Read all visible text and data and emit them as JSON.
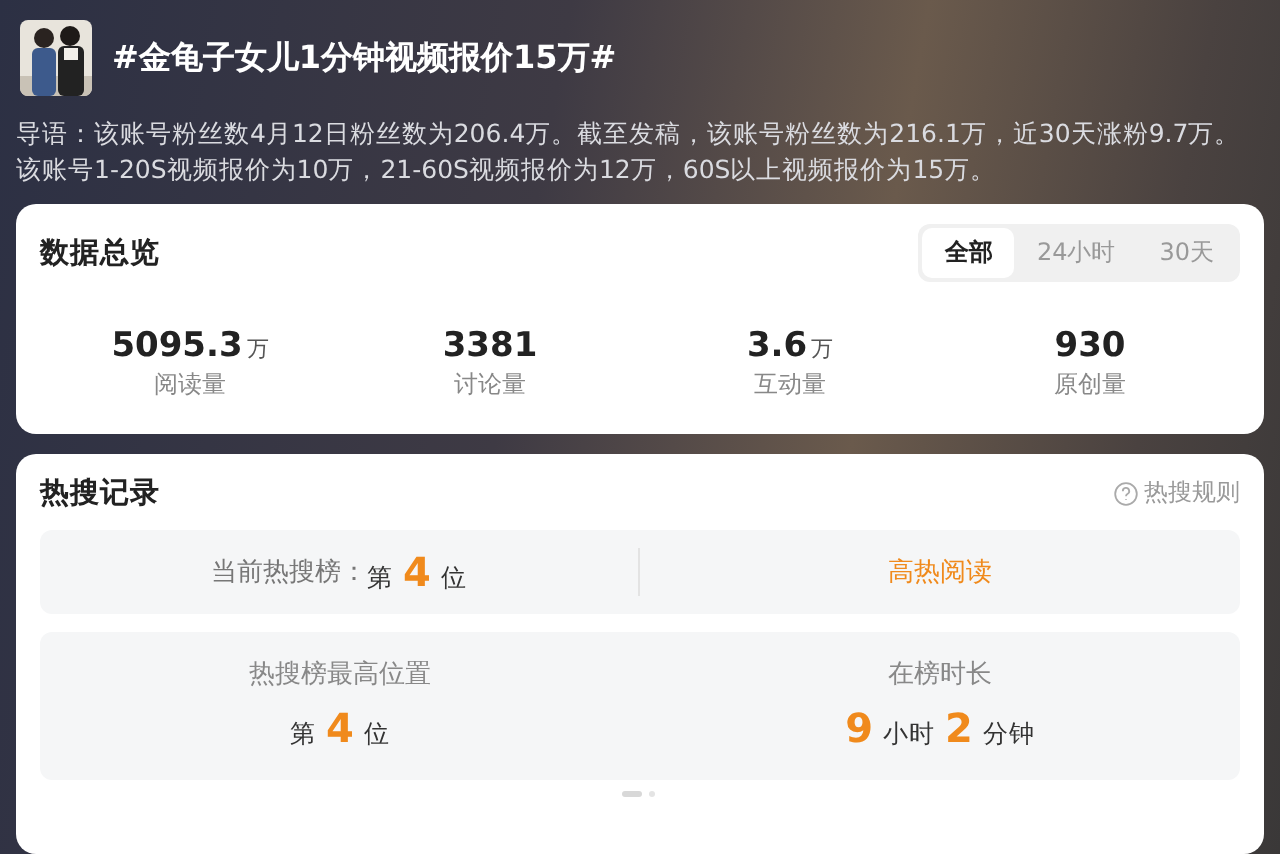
{
  "topic": {
    "title": "#金龟子女儿1分钟视频报价15万#",
    "intro": "导语：该账号粉丝数4月12日粉丝数为206.4万。截至发稿，该账号粉丝数为216.1万，近30天涨粉9.7万。该账号1-20S视频报价为10万，21-60S视频报价为12万，60S以上视频报价为15万。"
  },
  "overview": {
    "title": "数据总览",
    "tabs": [
      {
        "label": "全部",
        "selected": true
      },
      {
        "label": "24小时",
        "selected": false
      },
      {
        "label": "30天",
        "selected": false
      }
    ],
    "stats": [
      {
        "value": "5095.3",
        "unit": "万",
        "label": "阅读量"
      },
      {
        "value": "3381",
        "label": "讨论量"
      },
      {
        "value": "3.6",
        "unit": "万",
        "label": "互动量"
      },
      {
        "value": "930",
        "label": "原创量"
      }
    ]
  },
  "hot_record": {
    "title": "热搜记录",
    "rules_link": "热搜规则",
    "current": {
      "label": "当前热搜榜：",
      "parts": [
        {
          "text": "第",
          "kind": "unit"
        },
        {
          "text": "4",
          "kind": "number"
        },
        {
          "text": "位",
          "kind": "unit"
        }
      ]
    },
    "tag": "高热阅读",
    "details": [
      {
        "label": "热搜榜最高位置",
        "parts": [
          {
            "text": "第",
            "kind": "unit"
          },
          {
            "text": "4",
            "kind": "number"
          },
          {
            "text": "位",
            "kind": "unit"
          }
        ]
      },
      {
        "label": "在榜时长",
        "parts": [
          {
            "text": "9",
            "kind": "number"
          },
          {
            "text": "小时",
            "kind": "unit"
          },
          {
            "text": "2",
            "kind": "number"
          },
          {
            "text": "分钟",
            "kind": "unit"
          }
        ]
      }
    ]
  }
}
